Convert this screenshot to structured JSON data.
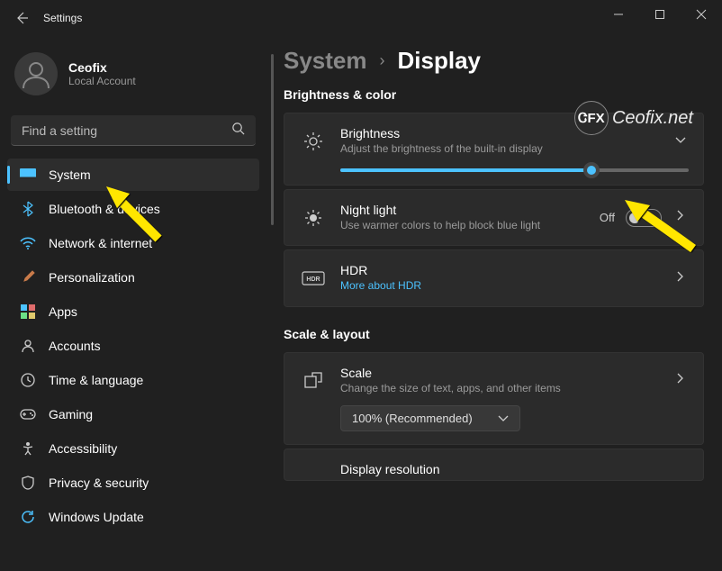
{
  "window": {
    "title": "Settings"
  },
  "profile": {
    "name": "Ceofix",
    "type": "Local Account"
  },
  "search": {
    "placeholder": "Find a setting"
  },
  "sidebar": {
    "items": [
      {
        "label": "System"
      },
      {
        "label": "Bluetooth & devices"
      },
      {
        "label": "Network & internet"
      },
      {
        "label": "Personalization"
      },
      {
        "label": "Apps"
      },
      {
        "label": "Accounts"
      },
      {
        "label": "Time & language"
      },
      {
        "label": "Gaming"
      },
      {
        "label": "Accessibility"
      },
      {
        "label": "Privacy & security"
      },
      {
        "label": "Windows Update"
      }
    ]
  },
  "breadcrumb": {
    "parent": "System",
    "current": "Display"
  },
  "sections": {
    "brightness_color": "Brightness & color",
    "scale_layout": "Scale & layout"
  },
  "cards": {
    "brightness": {
      "title": "Brightness",
      "desc": "Adjust the brightness of the built-in display",
      "slider_pct": 72
    },
    "nightlight": {
      "title": "Night light",
      "desc": "Use warmer colors to help block blue light",
      "state": "Off"
    },
    "hdr": {
      "title": "HDR",
      "link": "More about HDR"
    },
    "scale": {
      "title": "Scale",
      "desc": "Change the size of text, apps, and other items",
      "value": "100% (Recommended)"
    },
    "resolution": {
      "title": "Display resolution"
    }
  },
  "watermark": "Ceofix.net"
}
